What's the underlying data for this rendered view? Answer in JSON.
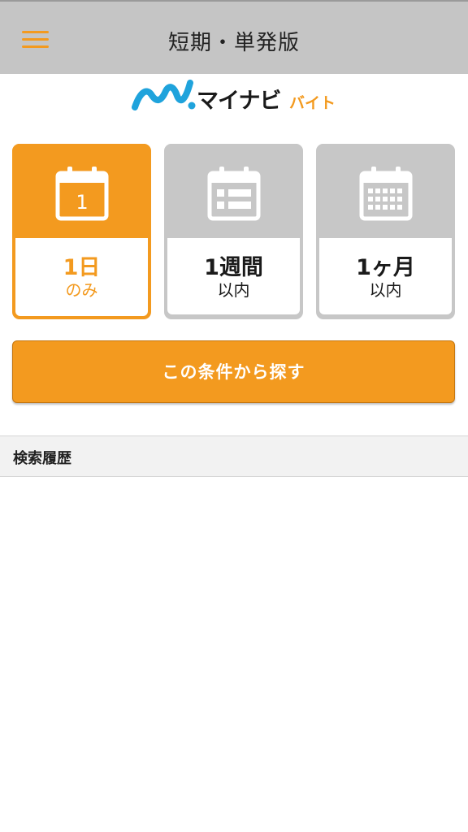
{
  "header": {
    "title": "短期・単発版"
  },
  "logo": {
    "main": "マイナビ",
    "sub": "バイト",
    "colors": {
      "wave": "#1fa3dc",
      "accent": "#f39a1f"
    }
  },
  "period_options": [
    {
      "line1": "1日",
      "line2": "のみ",
      "calendar_number": "1",
      "selected": true
    },
    {
      "line1": "1週間",
      "line2": "以内",
      "selected": false
    },
    {
      "line1": "1ヶ月",
      "line2": "以内",
      "selected": false
    }
  ],
  "search_button": {
    "label": "この条件から探す"
  },
  "history": {
    "title": "検索履歴"
  },
  "colors": {
    "accent": "#f39a1f",
    "header_bg": "#c5c5c5",
    "inactive": "#c7c7c7"
  }
}
